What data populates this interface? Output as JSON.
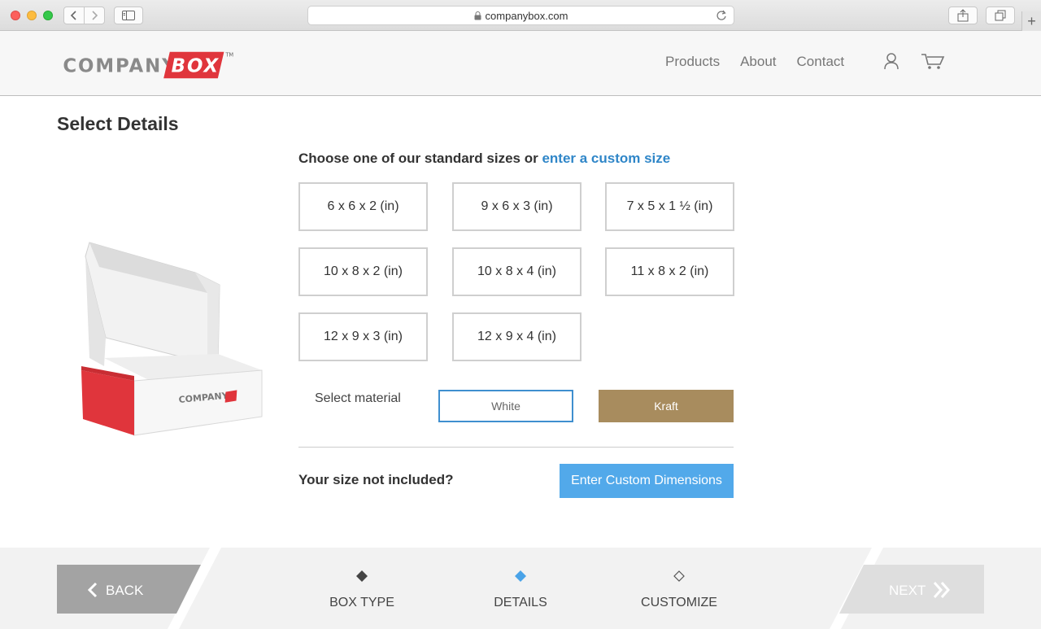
{
  "browser": {
    "url": "companybox.com"
  },
  "header": {
    "logo_word1": "COMPANY",
    "logo_word2": "BOX",
    "logo_tm": "TM",
    "nav": [
      "Products",
      "About",
      "Contact"
    ]
  },
  "main": {
    "title": "Select Details",
    "prompt_text": "Choose one of our standard sizes or ",
    "prompt_link": "enter a custom size",
    "sizes": [
      "6 x 6 x 2 (in)",
      "9 x 6 x 3 (in)",
      "7 x 5 x 1 ½ (in)",
      "10 x 8 x 2 (in)",
      "10 x 8 x 4 (in)",
      "11 x 8 x 2 (in)",
      "12 x 9 x 3 (in)",
      "12 x 9 x 4 (in)"
    ],
    "material_label": "Select material",
    "materials": [
      "White",
      "Kraft"
    ],
    "custom_question": "Your size not included?",
    "custom_button": "Enter Custom Dimensions"
  },
  "footer": {
    "back_label": "BACK",
    "next_label": "NEXT",
    "steps": [
      {
        "label": "BOX TYPE",
        "state": "done"
      },
      {
        "label": "DETAILS",
        "state": "active"
      },
      {
        "label": "CUSTOMIZE",
        "state": "pending"
      }
    ]
  },
  "colors": {
    "brand_red": "#e0353c",
    "link_blue": "#2f86c8",
    "primary_button": "#52a9ea",
    "kraft": "#a88c5e",
    "active_step": "#4aa3e8"
  }
}
